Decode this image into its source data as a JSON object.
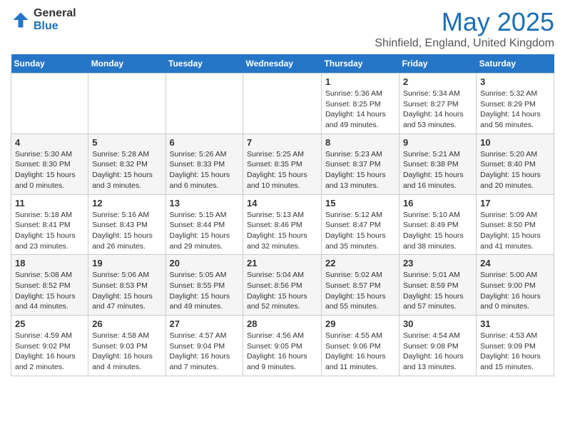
{
  "header": {
    "logo": {
      "general": "General",
      "blue": "Blue"
    },
    "title": "May 2025",
    "location": "Shinfield, England, United Kingdom"
  },
  "days_of_week": [
    "Sunday",
    "Monday",
    "Tuesday",
    "Wednesday",
    "Thursday",
    "Friday",
    "Saturday"
  ],
  "weeks": [
    [
      {
        "day": "",
        "sunrise": "",
        "sunset": "",
        "daylight": ""
      },
      {
        "day": "",
        "sunrise": "",
        "sunset": "",
        "daylight": ""
      },
      {
        "day": "",
        "sunrise": "",
        "sunset": "",
        "daylight": ""
      },
      {
        "day": "",
        "sunrise": "",
        "sunset": "",
        "daylight": ""
      },
      {
        "day": "1",
        "sunrise": "Sunrise: 5:36 AM",
        "sunset": "Sunset: 8:25 PM",
        "daylight": "Daylight: 14 hours and 49 minutes."
      },
      {
        "day": "2",
        "sunrise": "Sunrise: 5:34 AM",
        "sunset": "Sunset: 8:27 PM",
        "daylight": "Daylight: 14 hours and 53 minutes."
      },
      {
        "day": "3",
        "sunrise": "Sunrise: 5:32 AM",
        "sunset": "Sunset: 8:29 PM",
        "daylight": "Daylight: 14 hours and 56 minutes."
      }
    ],
    [
      {
        "day": "4",
        "sunrise": "Sunrise: 5:30 AM",
        "sunset": "Sunset: 8:30 PM",
        "daylight": "Daylight: 15 hours and 0 minutes."
      },
      {
        "day": "5",
        "sunrise": "Sunrise: 5:28 AM",
        "sunset": "Sunset: 8:32 PM",
        "daylight": "Daylight: 15 hours and 3 minutes."
      },
      {
        "day": "6",
        "sunrise": "Sunrise: 5:26 AM",
        "sunset": "Sunset: 8:33 PM",
        "daylight": "Daylight: 15 hours and 6 minutes."
      },
      {
        "day": "7",
        "sunrise": "Sunrise: 5:25 AM",
        "sunset": "Sunset: 8:35 PM",
        "daylight": "Daylight: 15 hours and 10 minutes."
      },
      {
        "day": "8",
        "sunrise": "Sunrise: 5:23 AM",
        "sunset": "Sunset: 8:37 PM",
        "daylight": "Daylight: 15 hours and 13 minutes."
      },
      {
        "day": "9",
        "sunrise": "Sunrise: 5:21 AM",
        "sunset": "Sunset: 8:38 PM",
        "daylight": "Daylight: 15 hours and 16 minutes."
      },
      {
        "day": "10",
        "sunrise": "Sunrise: 5:20 AM",
        "sunset": "Sunset: 8:40 PM",
        "daylight": "Daylight: 15 hours and 20 minutes."
      }
    ],
    [
      {
        "day": "11",
        "sunrise": "Sunrise: 5:18 AM",
        "sunset": "Sunset: 8:41 PM",
        "daylight": "Daylight: 15 hours and 23 minutes."
      },
      {
        "day": "12",
        "sunrise": "Sunrise: 5:16 AM",
        "sunset": "Sunset: 8:43 PM",
        "daylight": "Daylight: 15 hours and 26 minutes."
      },
      {
        "day": "13",
        "sunrise": "Sunrise: 5:15 AM",
        "sunset": "Sunset: 8:44 PM",
        "daylight": "Daylight: 15 hours and 29 minutes."
      },
      {
        "day": "14",
        "sunrise": "Sunrise: 5:13 AM",
        "sunset": "Sunset: 8:46 PM",
        "daylight": "Daylight: 15 hours and 32 minutes."
      },
      {
        "day": "15",
        "sunrise": "Sunrise: 5:12 AM",
        "sunset": "Sunset: 8:47 PM",
        "daylight": "Daylight: 15 hours and 35 minutes."
      },
      {
        "day": "16",
        "sunrise": "Sunrise: 5:10 AM",
        "sunset": "Sunset: 8:49 PM",
        "daylight": "Daylight: 15 hours and 38 minutes."
      },
      {
        "day": "17",
        "sunrise": "Sunrise: 5:09 AM",
        "sunset": "Sunset: 8:50 PM",
        "daylight": "Daylight: 15 hours and 41 minutes."
      }
    ],
    [
      {
        "day": "18",
        "sunrise": "Sunrise: 5:08 AM",
        "sunset": "Sunset: 8:52 PM",
        "daylight": "Daylight: 15 hours and 44 minutes."
      },
      {
        "day": "19",
        "sunrise": "Sunrise: 5:06 AM",
        "sunset": "Sunset: 8:53 PM",
        "daylight": "Daylight: 15 hours and 47 minutes."
      },
      {
        "day": "20",
        "sunrise": "Sunrise: 5:05 AM",
        "sunset": "Sunset: 8:55 PM",
        "daylight": "Daylight: 15 hours and 49 minutes."
      },
      {
        "day": "21",
        "sunrise": "Sunrise: 5:04 AM",
        "sunset": "Sunset: 8:56 PM",
        "daylight": "Daylight: 15 hours and 52 minutes."
      },
      {
        "day": "22",
        "sunrise": "Sunrise: 5:02 AM",
        "sunset": "Sunset: 8:57 PM",
        "daylight": "Daylight: 15 hours and 55 minutes."
      },
      {
        "day": "23",
        "sunrise": "Sunrise: 5:01 AM",
        "sunset": "Sunset: 8:59 PM",
        "daylight": "Daylight: 15 hours and 57 minutes."
      },
      {
        "day": "24",
        "sunrise": "Sunrise: 5:00 AM",
        "sunset": "Sunset: 9:00 PM",
        "daylight": "Daylight: 16 hours and 0 minutes."
      }
    ],
    [
      {
        "day": "25",
        "sunrise": "Sunrise: 4:59 AM",
        "sunset": "Sunset: 9:02 PM",
        "daylight": "Daylight: 16 hours and 2 minutes."
      },
      {
        "day": "26",
        "sunrise": "Sunrise: 4:58 AM",
        "sunset": "Sunset: 9:03 PM",
        "daylight": "Daylight: 16 hours and 4 minutes."
      },
      {
        "day": "27",
        "sunrise": "Sunrise: 4:57 AM",
        "sunset": "Sunset: 9:04 PM",
        "daylight": "Daylight: 16 hours and 7 minutes."
      },
      {
        "day": "28",
        "sunrise": "Sunrise: 4:56 AM",
        "sunset": "Sunset: 9:05 PM",
        "daylight": "Daylight: 16 hours and 9 minutes."
      },
      {
        "day": "29",
        "sunrise": "Sunrise: 4:55 AM",
        "sunset": "Sunset: 9:06 PM",
        "daylight": "Daylight: 16 hours and 11 minutes."
      },
      {
        "day": "30",
        "sunrise": "Sunrise: 4:54 AM",
        "sunset": "Sunset: 9:08 PM",
        "daylight": "Daylight: 16 hours and 13 minutes."
      },
      {
        "day": "31",
        "sunrise": "Sunrise: 4:53 AM",
        "sunset": "Sunset: 9:09 PM",
        "daylight": "Daylight: 16 hours and 15 minutes."
      }
    ]
  ]
}
